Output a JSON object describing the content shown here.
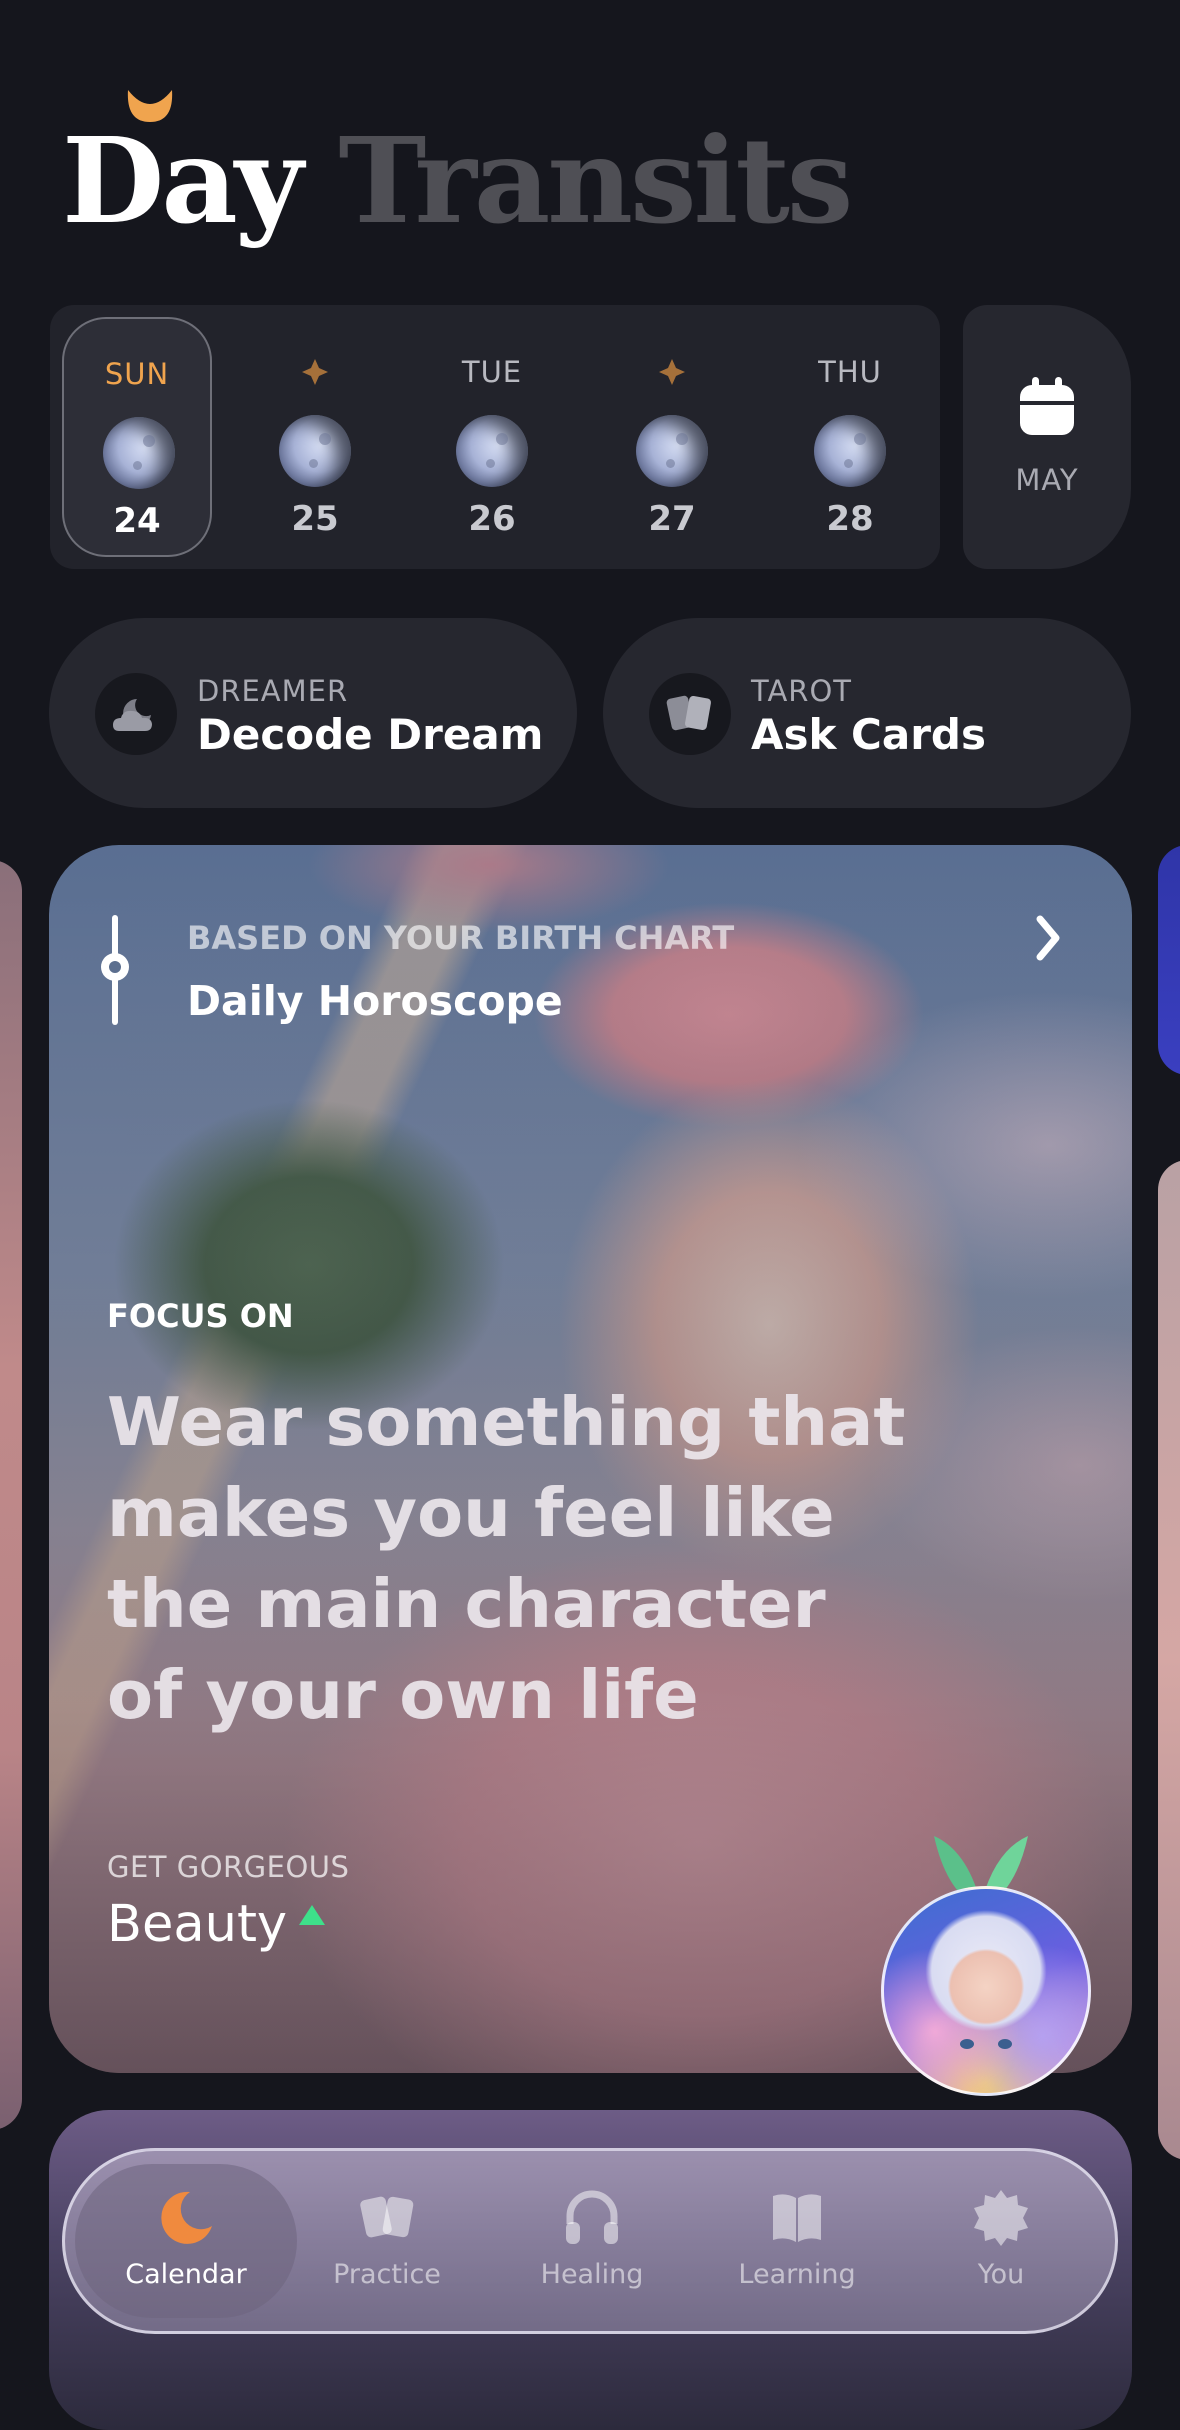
{
  "header": {
    "title_part1": "Day",
    "title_part2": "Transits",
    "accent_icon": "crescent-moon-icon"
  },
  "week": {
    "days": [
      {
        "name": "SUN",
        "number": "24",
        "selected": true
      },
      {
        "name": "",
        "marker": "diamond-icon",
        "number": "25",
        "selected": false
      },
      {
        "name": "TUE",
        "number": "26",
        "selected": false
      },
      {
        "name": "",
        "marker": "diamond-icon",
        "number": "27",
        "selected": false
      },
      {
        "name": "THU",
        "number": "28",
        "selected": false
      }
    ],
    "month_label": "MAY",
    "month_icon": "calendar-icon"
  },
  "pills": [
    {
      "kicker": "DREAMER",
      "label": "Decode Dream",
      "icon": "cloud-moon-icon"
    },
    {
      "kicker": "TAROT",
      "label": "Ask Cards",
      "icon": "cards-icon"
    }
  ],
  "card": {
    "kicker": "BASED ON YOUR BIRTH CHART",
    "title": "Daily Horoscope",
    "focus_label": "FOCUS ON",
    "quote": "Wear something that makes you feel like the main character of your own life",
    "category_kicker": "GET GORGEOUS",
    "category_value": "Beauty",
    "trend": "up"
  },
  "nav": {
    "items": [
      {
        "label": "Calendar",
        "icon": "moon-icon",
        "active": true
      },
      {
        "label": "Practice",
        "icon": "cards-icon",
        "active": false
      },
      {
        "label": "Healing",
        "icon": "headphones-icon",
        "active": false
      },
      {
        "label": "Learning",
        "icon": "book-icon",
        "active": false
      },
      {
        "label": "You",
        "icon": "gear-icon",
        "active": false
      }
    ]
  },
  "colors": {
    "background": "#15161d",
    "accent_orange": "#f0a44e",
    "trend_green": "#3ee08a"
  }
}
